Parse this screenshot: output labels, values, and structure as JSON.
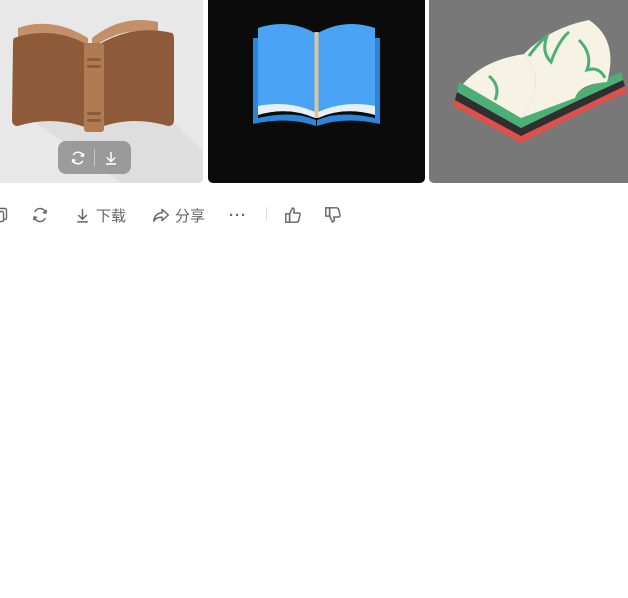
{
  "results": {
    "images": [
      {
        "name": "brown-closed-book-icon",
        "background": "#e8e8e8"
      },
      {
        "name": "blue-open-book-icon",
        "background": "#0b0b0b"
      },
      {
        "name": "green-open-book-icon",
        "background": "#787878"
      }
    ],
    "hover_overlay": {
      "regenerate_icon": "refresh-icon",
      "download_icon": "download-icon"
    }
  },
  "toolbar": {
    "copy_icon": "copy-icon",
    "regenerate_icon": "refresh-icon",
    "download_label": "下载",
    "share_label": "分享",
    "more_label": "···",
    "like_icon": "thumbs-up-icon",
    "dislike_icon": "thumbs-down-icon"
  },
  "colors": {
    "toolbar_text": "#666666",
    "book_brown": "#8d5b3a",
    "book_blue": "#4aa3f5",
    "book_green": "#4caf75",
    "book_red": "#e0504a"
  }
}
